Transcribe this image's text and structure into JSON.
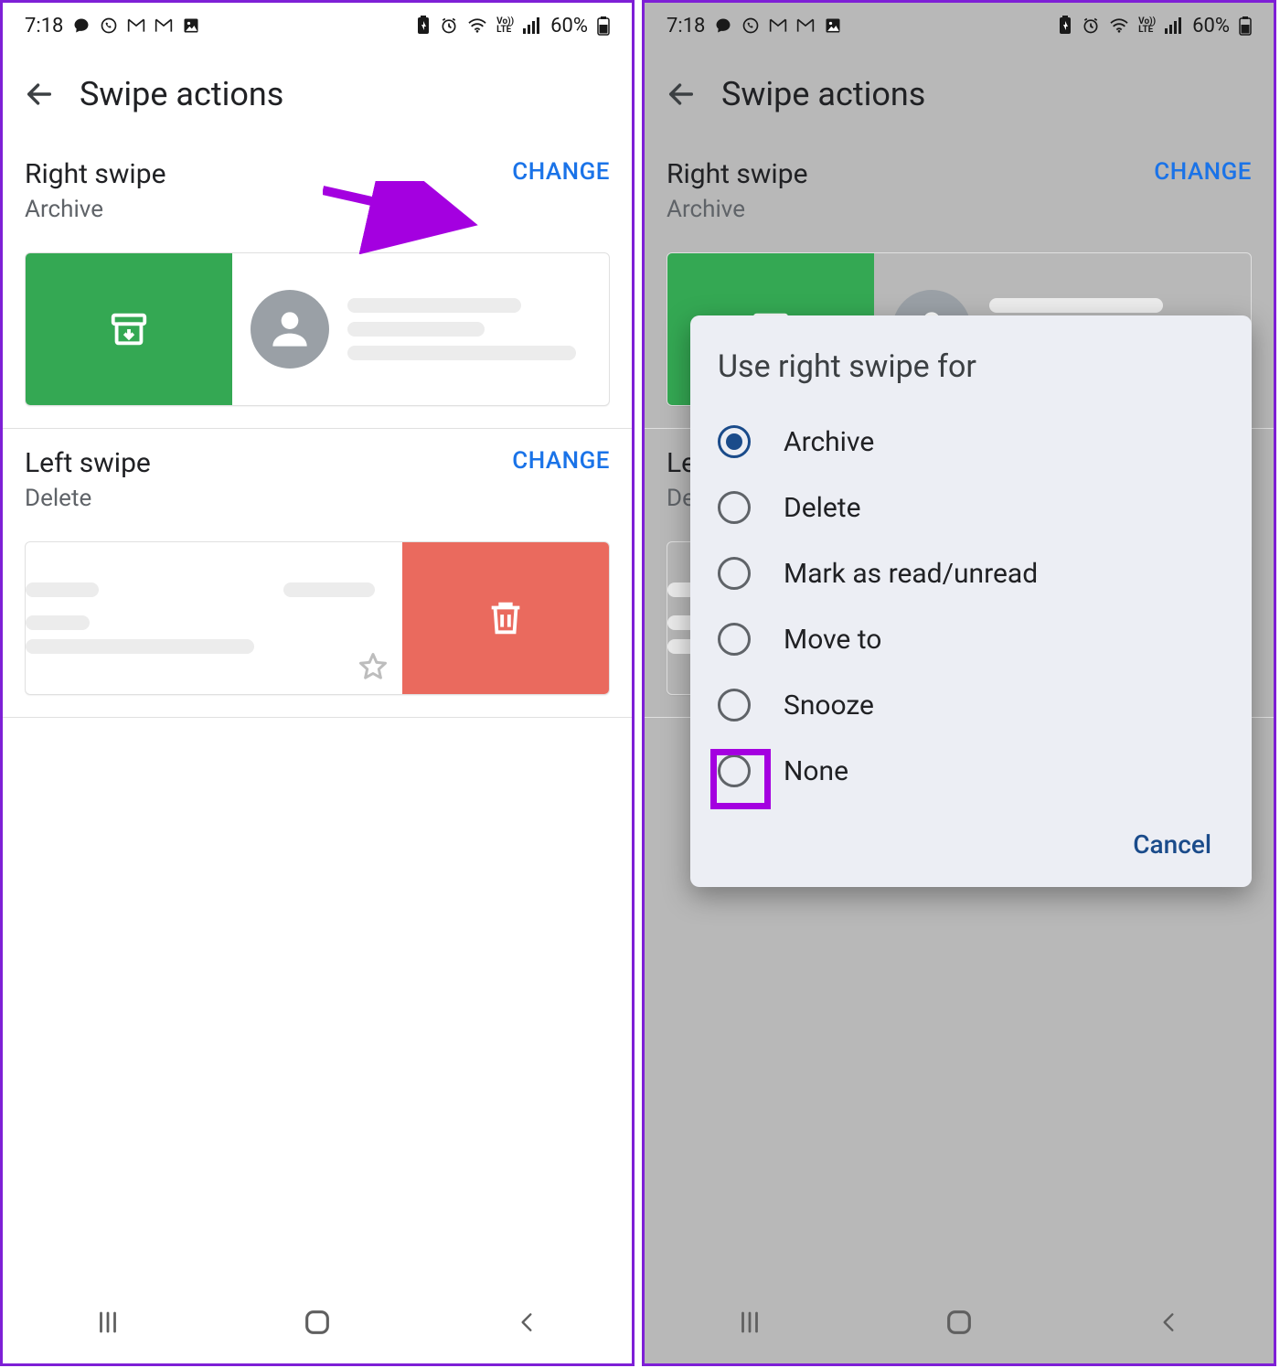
{
  "status": {
    "time": "7:18",
    "battery": "60%"
  },
  "appbar": {
    "title": "Swipe actions"
  },
  "right_swipe": {
    "title": "Right swipe",
    "subtitle": "Archive",
    "change": "CHANGE"
  },
  "left_swipe": {
    "title": "Left swipe",
    "subtitle": "Delete",
    "change": "CHANGE"
  },
  "dialog": {
    "title": "Use right swipe for",
    "options": {
      "archive": "Archive",
      "delete": "Delete",
      "mark": "Mark as read/unread",
      "move": "Move to",
      "snooze": "Snooze",
      "none": "None"
    },
    "selected": "archive",
    "cancel": "Cancel"
  }
}
